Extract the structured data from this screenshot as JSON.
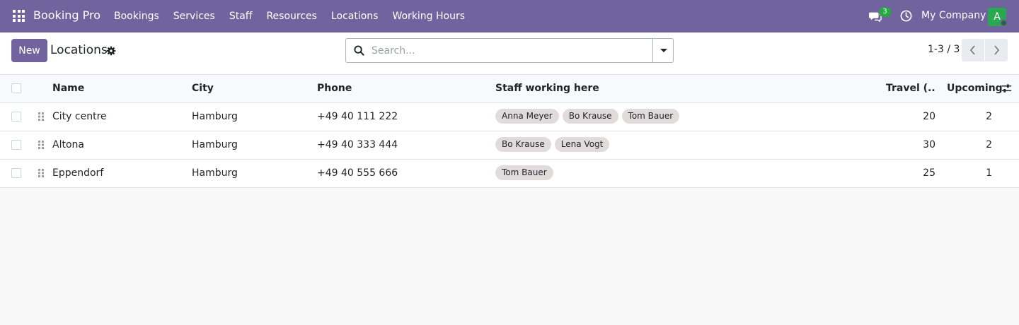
{
  "navbar": {
    "brand": "Booking Pro",
    "menu": [
      "Bookings",
      "Services",
      "Staff",
      "Resources",
      "Locations",
      "Working Hours"
    ],
    "messages_count": "3",
    "company": "My Company",
    "avatar_letter": "A",
    "background": "#71639e"
  },
  "control": {
    "new_label": "New",
    "title": "Locations",
    "search_placeholder": "Search...",
    "pager": "1-3 / 3"
  },
  "table": {
    "columns": {
      "name": "Name",
      "city": "City",
      "phone": "Phone",
      "staff": "Staff working here",
      "travel": "Travel (...",
      "upcoming": "Upcoming"
    },
    "rows": [
      {
        "name": "City centre",
        "city": "Hamburg",
        "phone": "+49 40 111 222",
        "staff": [
          "Anna Meyer",
          "Bo Krause",
          "Tom Bauer"
        ],
        "travel": "20",
        "upcoming": "2"
      },
      {
        "name": "Altona",
        "city": "Hamburg",
        "phone": "+49 40 333 444",
        "staff": [
          "Bo Krause",
          "Lena Vogt"
        ],
        "travel": "30",
        "upcoming": "2"
      },
      {
        "name": "Eppendorf",
        "city": "Hamburg",
        "phone": "+49 40 555 666",
        "staff": [
          "Tom Bauer"
        ],
        "travel": "25",
        "upcoming": "1"
      }
    ]
  },
  "colors": {
    "accent": "#71639e",
    "badge": "#28a745",
    "avatar": "#29a94f",
    "tag": "#e1dbdb"
  },
  "icons": [
    "apps-icon",
    "chat-icon",
    "clock-icon",
    "gear-icon",
    "search-icon",
    "chevron-down-icon",
    "chevron-left-icon",
    "chevron-right-icon",
    "drag-handle-icon",
    "optional-columns-icon"
  ]
}
